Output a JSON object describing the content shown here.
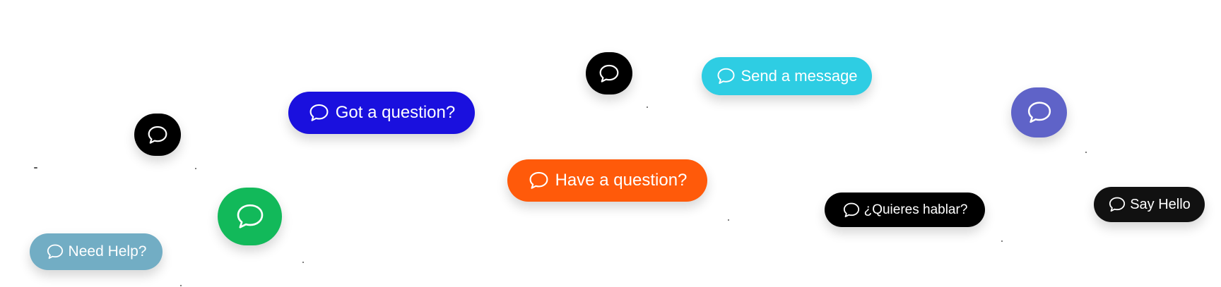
{
  "widgets": {
    "need_help": {
      "label": "Need Help?",
      "color": "#72adc4",
      "icon": "chat-bubble-icon"
    },
    "green_round": {
      "color": "#12b95a",
      "icon": "chat-bubble-icon"
    },
    "black_round_1": {
      "color": "#000000",
      "icon": "chat-bubble-icon"
    },
    "got_question": {
      "label": "Got a question?",
      "color": "#1a10de",
      "icon": "chat-bubble-icon"
    },
    "black_round_2": {
      "color": "#000000",
      "icon": "chat-bubble-icon"
    },
    "have_question": {
      "label": "Have a question?",
      "color": "#ff5a0a",
      "icon": "chat-bubble-icon"
    },
    "send_message": {
      "label": "Send a message",
      "color": "#2ecde3",
      "icon": "chat-bubble-icon"
    },
    "quieres_hablar": {
      "label": "¿Quieres hablar?",
      "color": "#000000",
      "icon": "chat-bubble-icon"
    },
    "indigo_round": {
      "color": "#5f63c8",
      "icon": "chat-bubble-icon"
    },
    "say_hello": {
      "label": "Say Hello",
      "color": "#111111",
      "icon": "chat-bubble-icon"
    }
  }
}
